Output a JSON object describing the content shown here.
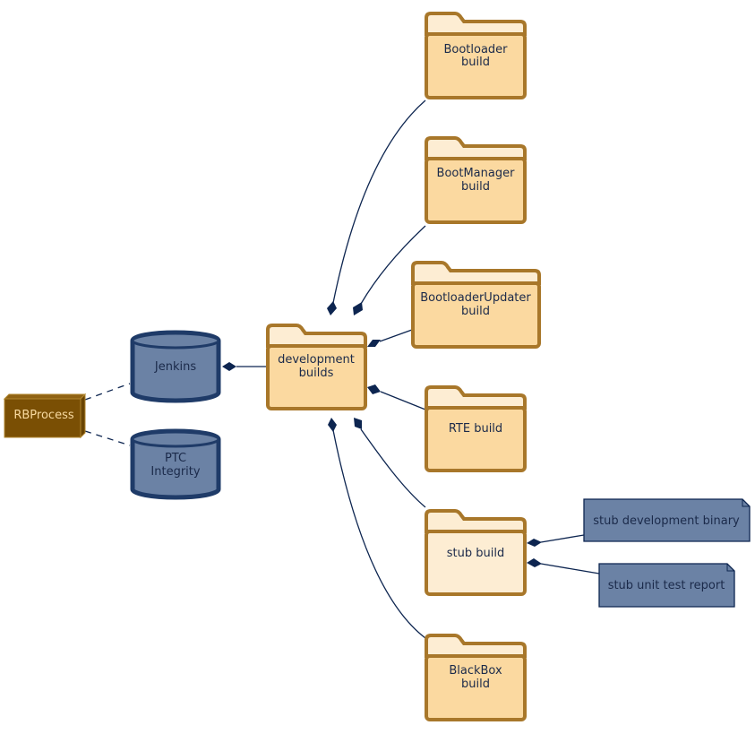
{
  "diagram": {
    "type": "artifact-structure",
    "colors": {
      "folder_fill": "#fbd9a0",
      "folder_fill_light": "#fdedd3",
      "folder_stroke": "#a8772a",
      "database_fill": "#6b82a5",
      "database_stroke": "#1f3b68",
      "node_fill": "#7a4f04",
      "node_text": "#f7d9a0",
      "edge": "#0d2550",
      "note_fill": "#6b82a5"
    },
    "nodes": {
      "rbprocess": {
        "label": "RBProcess",
        "kind": "node"
      },
      "jenkins": {
        "label": "Jenkins",
        "kind": "database"
      },
      "ptc": {
        "line1": "PTC",
        "line2": "Integrity",
        "kind": "database"
      },
      "devbuilds": {
        "line1": "development",
        "line2": "builds",
        "kind": "folder"
      },
      "bootloader": {
        "line1": "Bootloader",
        "line2": "build",
        "kind": "folder"
      },
      "bootmanager": {
        "line1": "BootManager",
        "line2": "build",
        "kind": "folder"
      },
      "blupdater": {
        "line1": "BootloaderUpdater",
        "line2": "build",
        "kind": "folder"
      },
      "rte": {
        "label": "RTE build",
        "kind": "folder"
      },
      "stub": {
        "label": "stub build",
        "kind": "folder"
      },
      "blackbox": {
        "line1": "BlackBox",
        "line2": "build",
        "kind": "folder"
      },
      "stub_binary": {
        "label": "stub development binary",
        "kind": "artifact"
      },
      "stub_report": {
        "label": "stub unit test report",
        "kind": "artifact"
      }
    },
    "edges": [
      {
        "from": "rbprocess",
        "to": "jenkins",
        "style": "dashed"
      },
      {
        "from": "rbprocess",
        "to": "ptc",
        "style": "dashed"
      },
      {
        "from": "devbuilds",
        "to": "jenkins",
        "style": "composition"
      },
      {
        "from": "devbuilds",
        "to": "bootloader",
        "style": "composition"
      },
      {
        "from": "devbuilds",
        "to": "bootmanager",
        "style": "composition"
      },
      {
        "from": "devbuilds",
        "to": "blupdater",
        "style": "composition"
      },
      {
        "from": "devbuilds",
        "to": "rte",
        "style": "composition"
      },
      {
        "from": "devbuilds",
        "to": "stub",
        "style": "composition"
      },
      {
        "from": "devbuilds",
        "to": "blackbox",
        "style": "composition"
      },
      {
        "from": "stub",
        "to": "stub_binary",
        "style": "composition"
      },
      {
        "from": "stub",
        "to": "stub_report",
        "style": "composition"
      }
    ]
  }
}
